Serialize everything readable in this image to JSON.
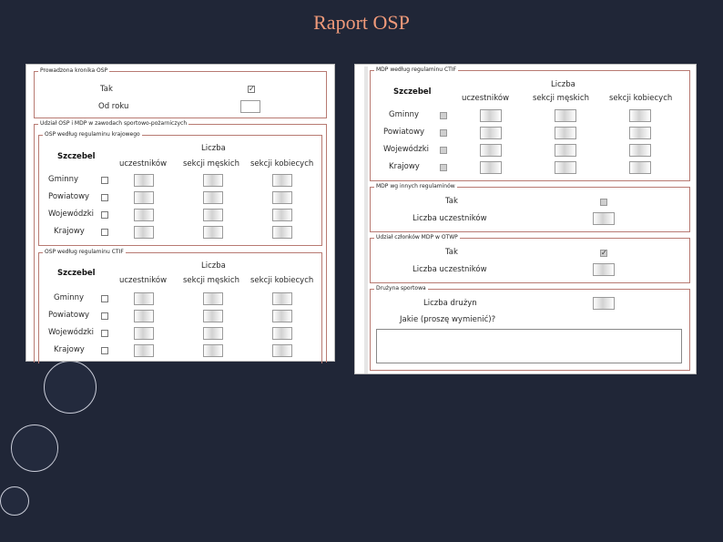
{
  "slide": {
    "title": "Raport OSP"
  },
  "left_form": {
    "kronika": {
      "legend": "Prowadzona kronika OSP",
      "tak_label": "Tak",
      "od_roku_label": "Od roku"
    },
    "udzial": {
      "legend": "Udział OSP i MDP w zawodach sportowo-pożarniczych",
      "krajowy": {
        "legend": "OSP według regulaminu krajowego",
        "header_szczebel": "Szczebel",
        "header_liczba": "Liczba",
        "header_uczestnikow": "uczestników",
        "header_meskich": "sekcji męskich",
        "header_kobiecych": "sekcji kobiecych",
        "rows": [
          "Gminny",
          "Powiatowy",
          "Wojewódzki",
          "Krajowy"
        ]
      },
      "ctif": {
        "legend": "OSP według regulaminu CTIF",
        "header_szczebel": "Szczebel",
        "header_liczba": "Liczba",
        "header_uczestnikow": "uczestników",
        "header_meskich": "sekcji męskich",
        "header_kobiecych": "sekcji kobiecych",
        "rows": [
          "Gminny",
          "Powiatowy",
          "Wojewódzki",
          "Krajowy"
        ]
      }
    }
  },
  "right_form": {
    "mdp_ctif": {
      "legend": "MDP według regulaminu CTIF",
      "header_szczebel": "Szczebel",
      "header_liczba": "Liczba",
      "header_uczestnikow": "uczestników",
      "header_meskich": "sekcji męskich",
      "header_kobiecych": "sekcji kobiecych",
      "rows": [
        "Gminny",
        "Powiatowy",
        "Wojewódzki",
        "Krajowy"
      ]
    },
    "mdp_inne": {
      "legend": "MDP wg innych regulaminów",
      "tak_label": "Tak",
      "liczba_label": "Liczba uczestników"
    },
    "otwp": {
      "legend": "Udział członków MDP w OTWP",
      "tak_label": "Tak",
      "liczba_label": "Liczba uczestników"
    },
    "druzyna": {
      "legend": "Drużyna sportowa",
      "liczba_label": "Liczba drużyn",
      "jakie_label": "Jakie (proszę wymienić)?"
    }
  },
  "colors": {
    "background": "#202637",
    "title": "#f09a7a",
    "fieldset_border": "#b87a72"
  }
}
